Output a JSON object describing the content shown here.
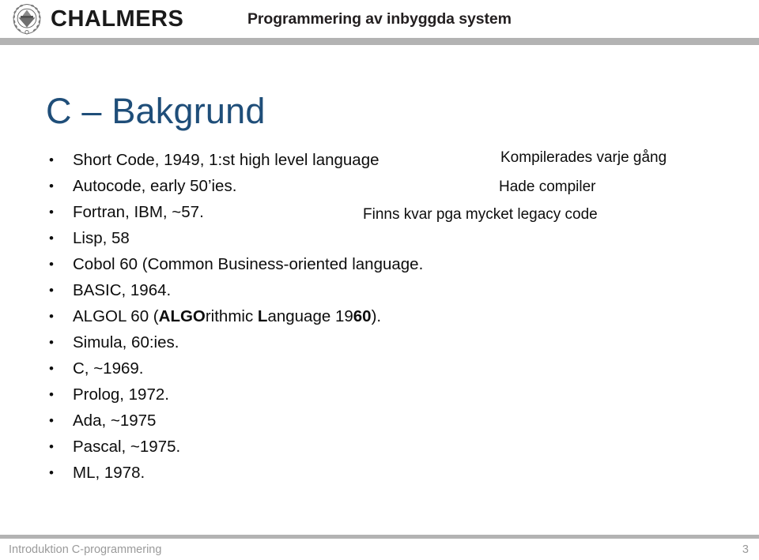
{
  "header": {
    "logo_wordmark": "CHALMERS",
    "logo_icon": "chalmers-seal-icon",
    "course_title": "Programmering av inbyggda system"
  },
  "slide": {
    "title": "C – Bakgrund",
    "title_color": "#1F4E79",
    "rule_color": "#B3B3B3",
    "bullet_glyph": "•",
    "bullets": [
      {
        "text": "Short Code, 1949, 1:st high level language"
      },
      {
        "text": "Autocode, early 50’ies."
      },
      {
        "text": "Fortran, IBM, ~57."
      },
      {
        "text": "Lisp, 58"
      },
      {
        "text": "Cobol 60 (Common Business-oriented language."
      },
      {
        "text": "BASIC, 1964."
      },
      {
        "html": "ALGOL 60 (<b>ALGO</b>rithmic <b>L</b>anguage 19<b>60</b>).",
        "text": "ALGOL 60 (ALGOrithmic Language 1960)."
      },
      {
        "text": "Simula, 60:ies."
      },
      {
        "text": "C, ~1969."
      },
      {
        "text": "Prolog, 1972."
      },
      {
        "text": "Ada, ~1975"
      },
      {
        "text": "Pascal, ~1975."
      },
      {
        "text": "ML, 1978."
      }
    ],
    "annotations": [
      {
        "text": "Kompilerades varje gång"
      },
      {
        "text": "Hade compiler"
      },
      {
        "text": "Finns kvar pga mycket legacy code"
      }
    ]
  },
  "footer": {
    "label": "Introduktion C-programmering",
    "page_number": "3",
    "color": "#9A9A9A"
  }
}
